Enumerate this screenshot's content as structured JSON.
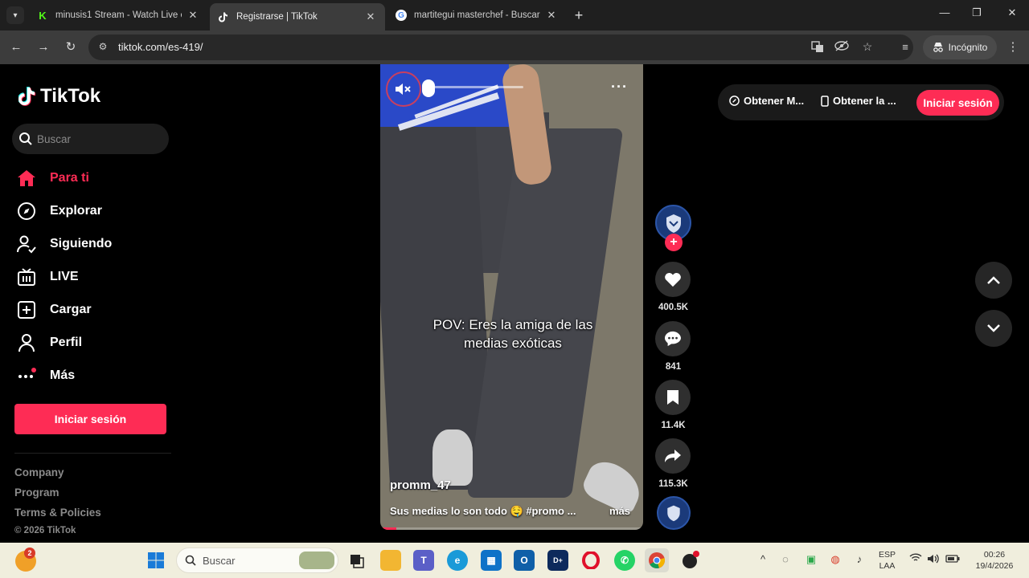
{
  "browser": {
    "tabs": [
      {
        "title": "minusis1 Stream - Watch Live o",
        "active": false
      },
      {
        "title": "Registrarse | TikTok",
        "active": true
      },
      {
        "title": "martitegui masterchef - Buscar",
        "active": false
      }
    ],
    "url": "tiktok.com/es-419/",
    "incognito_label": "Incógnito"
  },
  "tiktok": {
    "logo": "TikTok",
    "search_placeholder": "Buscar",
    "nav": [
      {
        "label": "Para ti",
        "active": true
      },
      {
        "label": "Explorar"
      },
      {
        "label": "Siguiendo"
      },
      {
        "label": "LIVE"
      },
      {
        "label": "Cargar"
      },
      {
        "label": "Perfil"
      },
      {
        "label": "Más"
      }
    ],
    "login_label": "Iniciar sesión",
    "footer": {
      "company": "Company",
      "program": "Program",
      "terms": "Terms & Policies",
      "copyright": "© 2026 TikTok"
    },
    "header": {
      "get_coins": "Obtener M...",
      "get_app": "Obtener la ...",
      "login": "Iniciar sesión"
    },
    "video": {
      "caption_line1": "POV: Eres la amiga de las",
      "caption_line2": "medias exóticas",
      "author": "promm_47",
      "description": "Sus medias lo son todo 🤤 #promo ...",
      "more": "más",
      "progress": 0.06,
      "volume": 0.0
    },
    "actions": {
      "likes": "400.5K",
      "comments": "841",
      "saves": "11.4K",
      "shares": "115.3K"
    },
    "colors": {
      "accent": "#fe2c55",
      "background": "#000000"
    }
  },
  "taskbar": {
    "search_placeholder": "Buscar",
    "weather_badge": "2",
    "language_line1": "ESP",
    "language_line2": "LAA",
    "time": "00:26",
    "date": "19/4/2026"
  }
}
